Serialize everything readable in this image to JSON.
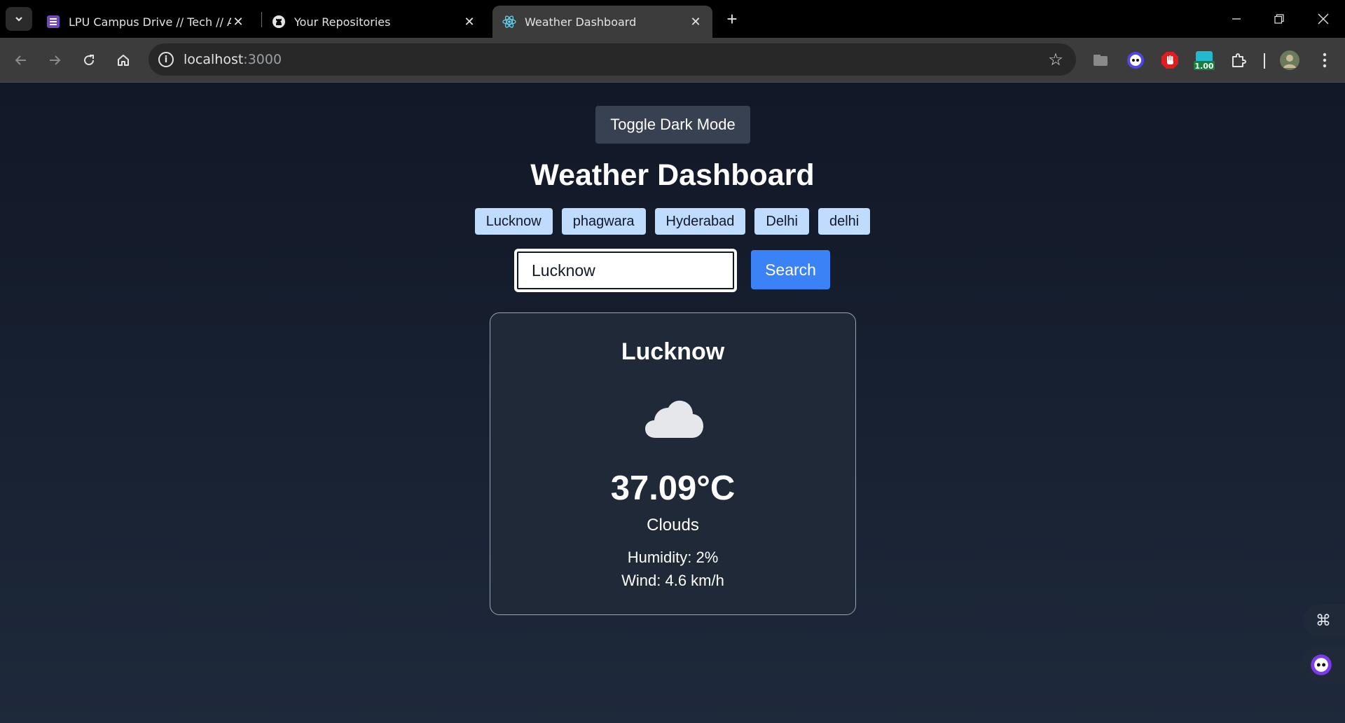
{
  "browser": {
    "tabs": [
      {
        "title": "LPU Campus Drive // Tech // As",
        "favicon": "forms-icon"
      },
      {
        "title": "Your Repositories",
        "favicon": "github-icon"
      },
      {
        "title": "Weather Dashboard",
        "favicon": "react-icon"
      }
    ],
    "url_host": "localhost",
    "url_port": ":3000",
    "extension_badge": "1.00"
  },
  "page": {
    "toggle_label": "Toggle Dark Mode",
    "title": "Weather Dashboard",
    "recent_cities": [
      "Lucknow",
      "phagwara",
      "Hyderabad",
      "Delhi",
      "delhi"
    ],
    "search": {
      "value": "Lucknow",
      "button_label": "Search"
    },
    "weather": {
      "city": "Lucknow",
      "icon": "cloud-icon",
      "temperature": "37.09°C",
      "condition": "Clouds",
      "humidity": "Humidity: 2%",
      "wind": "Wind: 4.6 km/h"
    }
  },
  "colors": {
    "accent": "#3b82f6",
    "chip": "#bfdbfe",
    "card": "#1f2937",
    "page_bg": "#0f172a"
  }
}
